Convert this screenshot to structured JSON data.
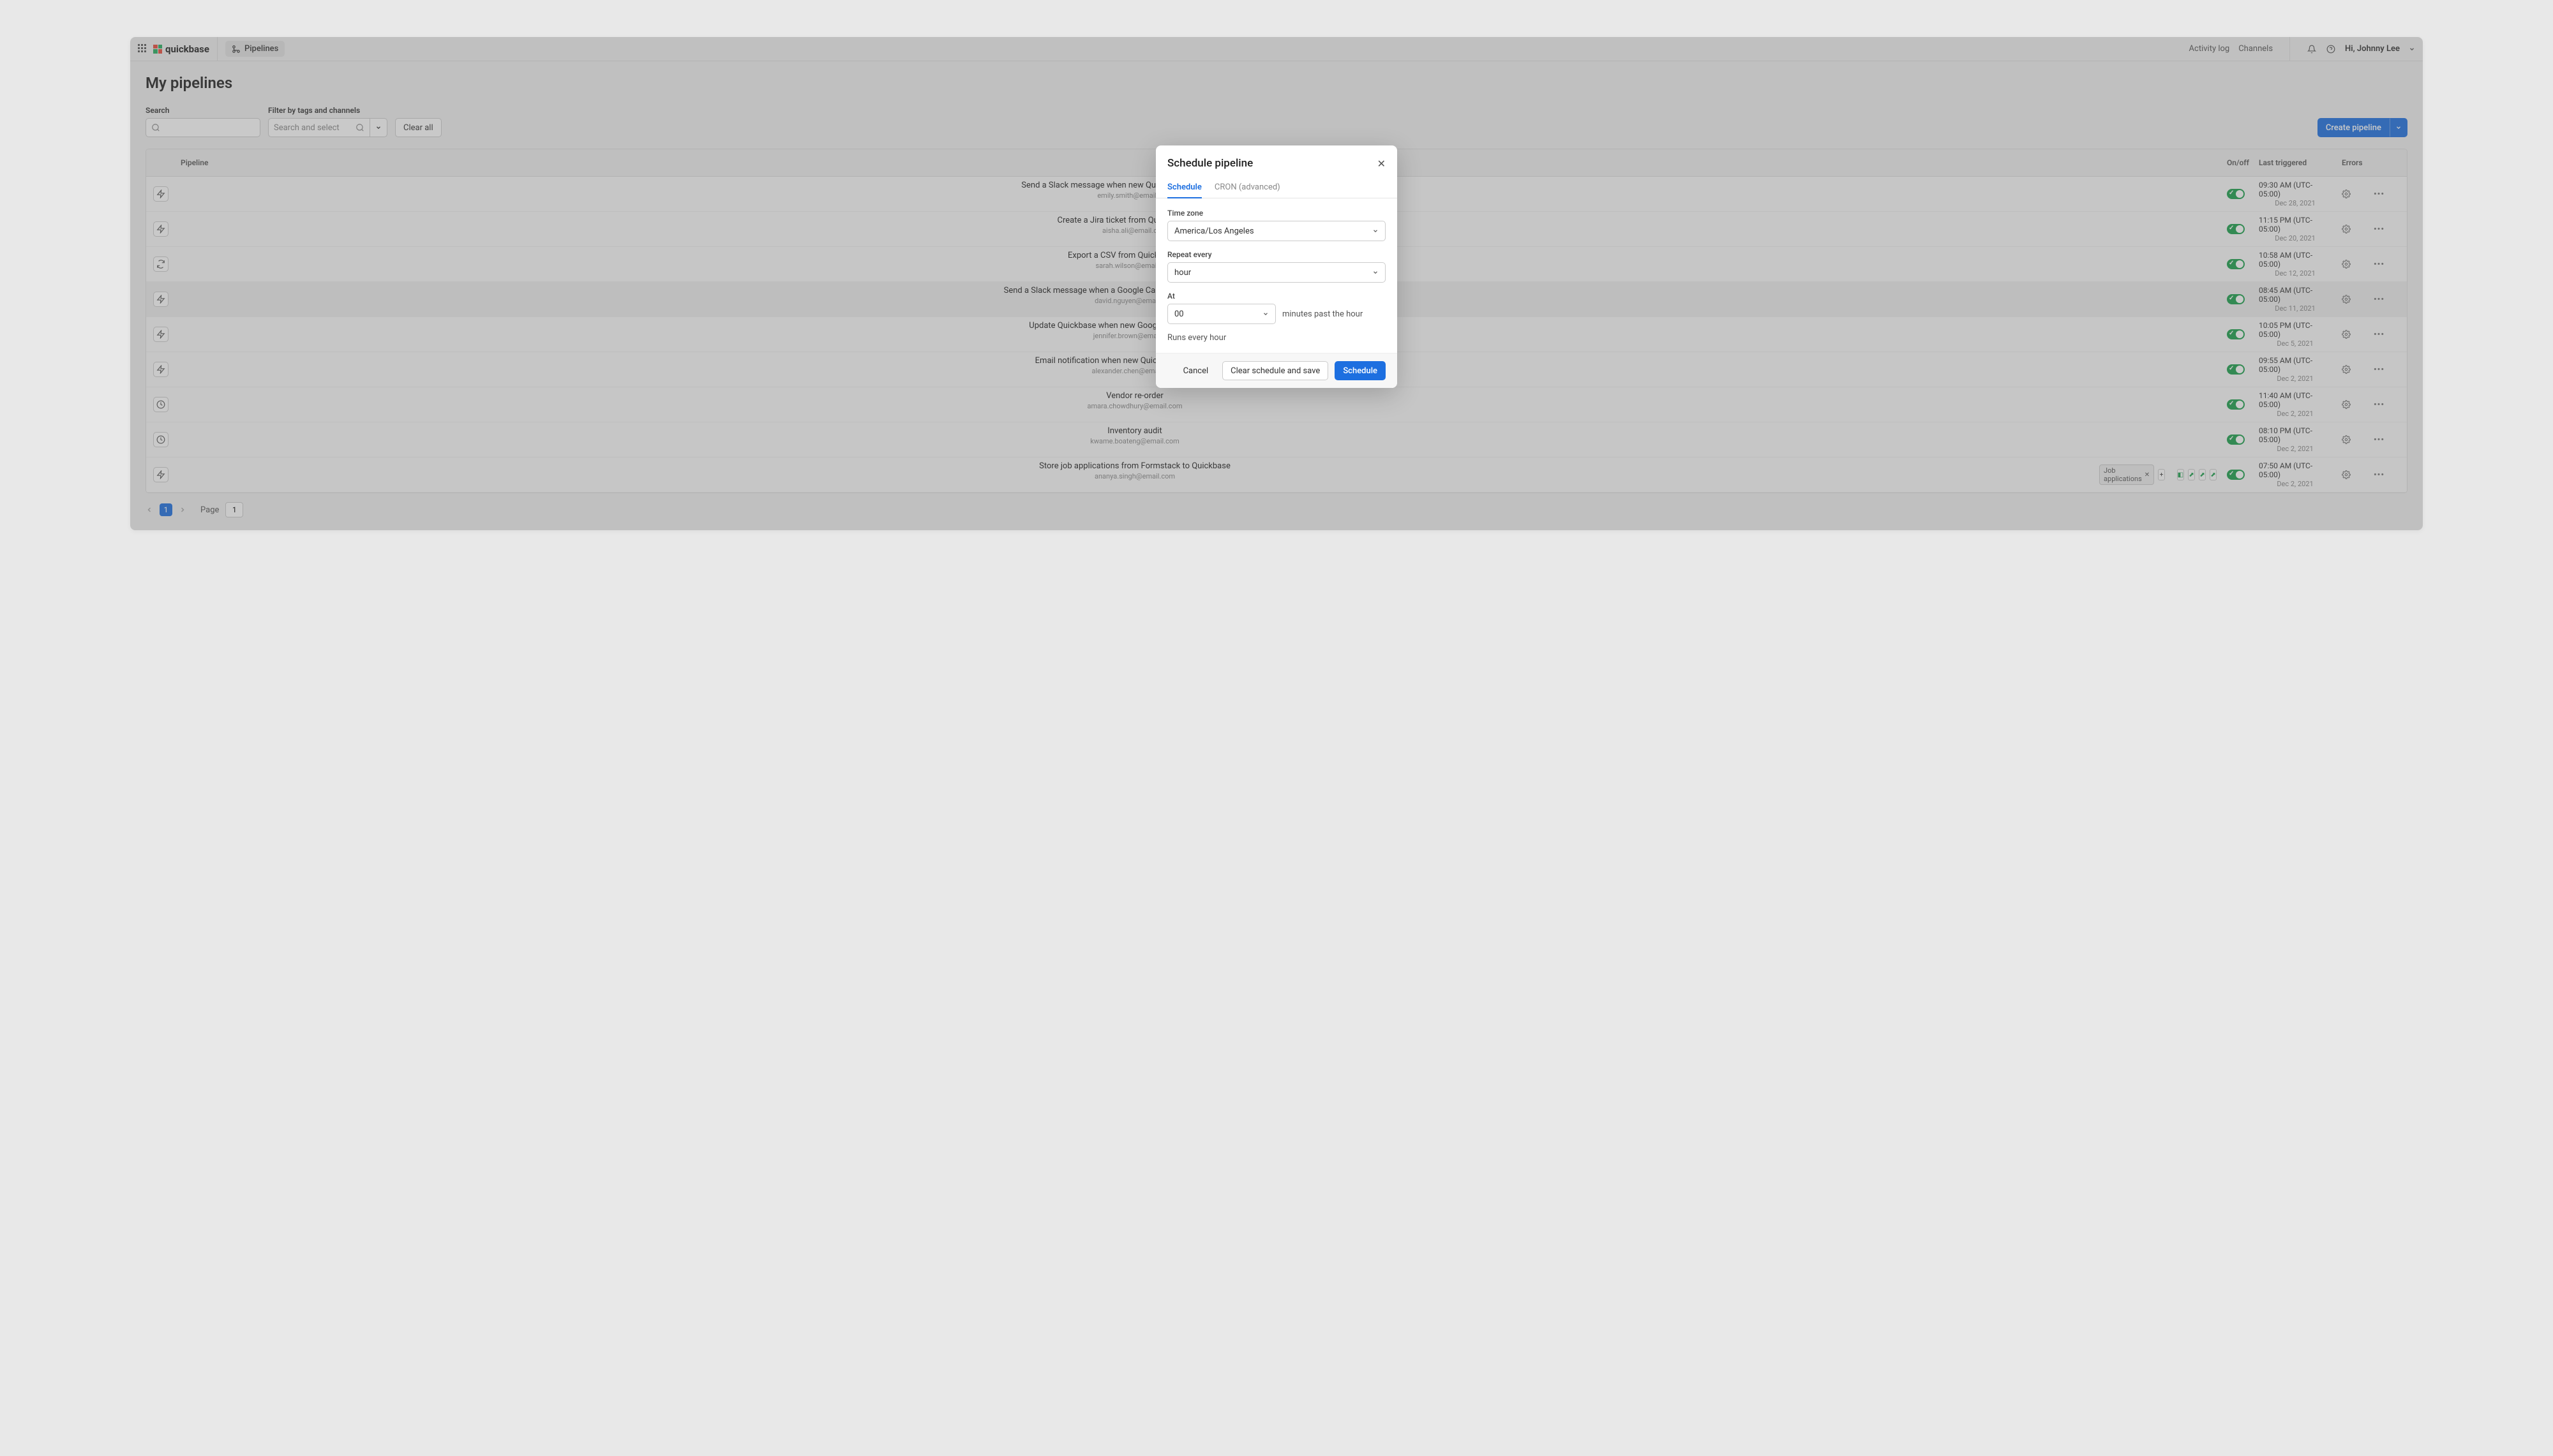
{
  "topbar": {
    "brand": "quickbase",
    "section": "Pipelines",
    "links": {
      "activity": "Activity log",
      "channels": "Channels"
    },
    "greeting": "Hi, Johnny Lee"
  },
  "page": {
    "title": "My pipelines",
    "search_label": "Search",
    "filter_label": "Filter by tags and channels",
    "filter_placeholder": "Search and select",
    "clear_all": "Clear all",
    "create": "Create pipeline"
  },
  "columns": {
    "pipeline": "Pipeline",
    "onoff": "On/off",
    "last": "Last triggered",
    "errors": "Errors"
  },
  "rows": [
    {
      "icon": "trigger",
      "title": "Send a Slack message when new Quickbase record is created",
      "email": "emily.smith@email.com",
      "time": "09:30 AM (UTC-05:00)",
      "date": "Dec 28, 2021"
    },
    {
      "icon": "trigger",
      "title": "Create a Jira ticket from Quickbase Forms",
      "email": "aisha.ali@email.com",
      "time": "11:15 PM (UTC-05:00)",
      "date": "Dec 20, 2021"
    },
    {
      "icon": "sync",
      "title": "Export a CSV from Quickbase to Box",
      "email": "sarah.wilson@email.com",
      "time": "10:58 AM (UTC-05:00)",
      "date": "Dec 12, 2021"
    },
    {
      "icon": "trigger",
      "title": "Send a Slack message when a Google Calendar event has been created",
      "email": "david.nguyen@email.com",
      "time": "08:45 AM (UTC-05:00)",
      "date": "Dec 11, 2021"
    },
    {
      "icon": "trigger",
      "title": "Update Quickbase when new Google Sheet row is created",
      "email": "jennifer.brown@email.com",
      "time": "10:05 PM (UTC-05:00)",
      "date": "Dec 5, 2021"
    },
    {
      "icon": "trigger",
      "title": "Email notification when new Quickbase record created",
      "email": "alexander.chen@email.com",
      "time": "09:55 AM (UTC-05:00)",
      "date": "Dec 2, 2021"
    },
    {
      "icon": "clock",
      "title": "Vendor re-order",
      "email": "amara.chowdhury@email.com",
      "time": "11:40 AM (UTC-05:00)",
      "date": "Dec 2, 2021"
    },
    {
      "icon": "clock",
      "title": "Inventory audit",
      "email": "kwame.boateng@email.com",
      "time": "08:10 PM (UTC-05:00)",
      "date": "Dec 2, 2021"
    },
    {
      "icon": "trigger",
      "title": "Store job applications from Formstack to Quickbase",
      "email": "ananya.singh@email.com",
      "time": "07:50 AM (UTC-05:00)",
      "date": "Dec 2, 2021",
      "tag": "Job applications"
    }
  ],
  "pager": {
    "page_label": "Page",
    "current": "1",
    "value": "1"
  },
  "modal": {
    "title": "Schedule pipeline",
    "tab_schedule": "Schedule",
    "tab_cron": "CRON (advanced)",
    "tz_label": "Time zone",
    "tz_value": "America/Los Angeles",
    "repeat_label": "Repeat every",
    "repeat_value": "hour",
    "at_label": "At",
    "at_value": "00",
    "at_helper": "minutes past the hour",
    "summary": "Runs every hour",
    "cancel": "Cancel",
    "clear": "Clear schedule and save",
    "schedule": "Schedule"
  }
}
